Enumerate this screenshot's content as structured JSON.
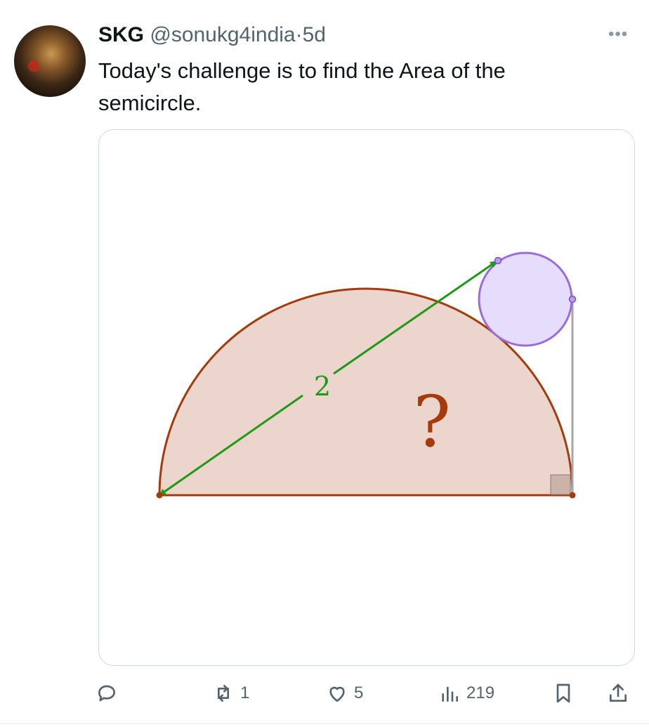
{
  "tweet": {
    "author_name": "SKG",
    "author_handle": "@sonukg4india",
    "separator": "·",
    "time": "5d",
    "more_icon": "more-icon",
    "text": "Today's challenge is to find the Area of the semicircle."
  },
  "figure": {
    "distance_label": "2",
    "unknown_label": "?",
    "colors": {
      "semicircle_fill": "#ecd5cc",
      "semicircle_stroke": "#a53a0c",
      "circle_fill": "#e6dcfc",
      "circle_stroke": "#9b6cde",
      "arrow": "#1e9a16",
      "tangent_line": "#a6a6a6",
      "right_angle_fill": "#cbb3aa"
    }
  },
  "actions": {
    "reply": {
      "icon": "reply-icon",
      "count": ""
    },
    "repost": {
      "icon": "repost-icon",
      "count": "1"
    },
    "like": {
      "icon": "heart-icon",
      "count": "5"
    },
    "views": {
      "icon": "views-icon",
      "count": "219"
    },
    "bookmark": {
      "icon": "bookmark-icon"
    },
    "share": {
      "icon": "share-icon"
    }
  }
}
